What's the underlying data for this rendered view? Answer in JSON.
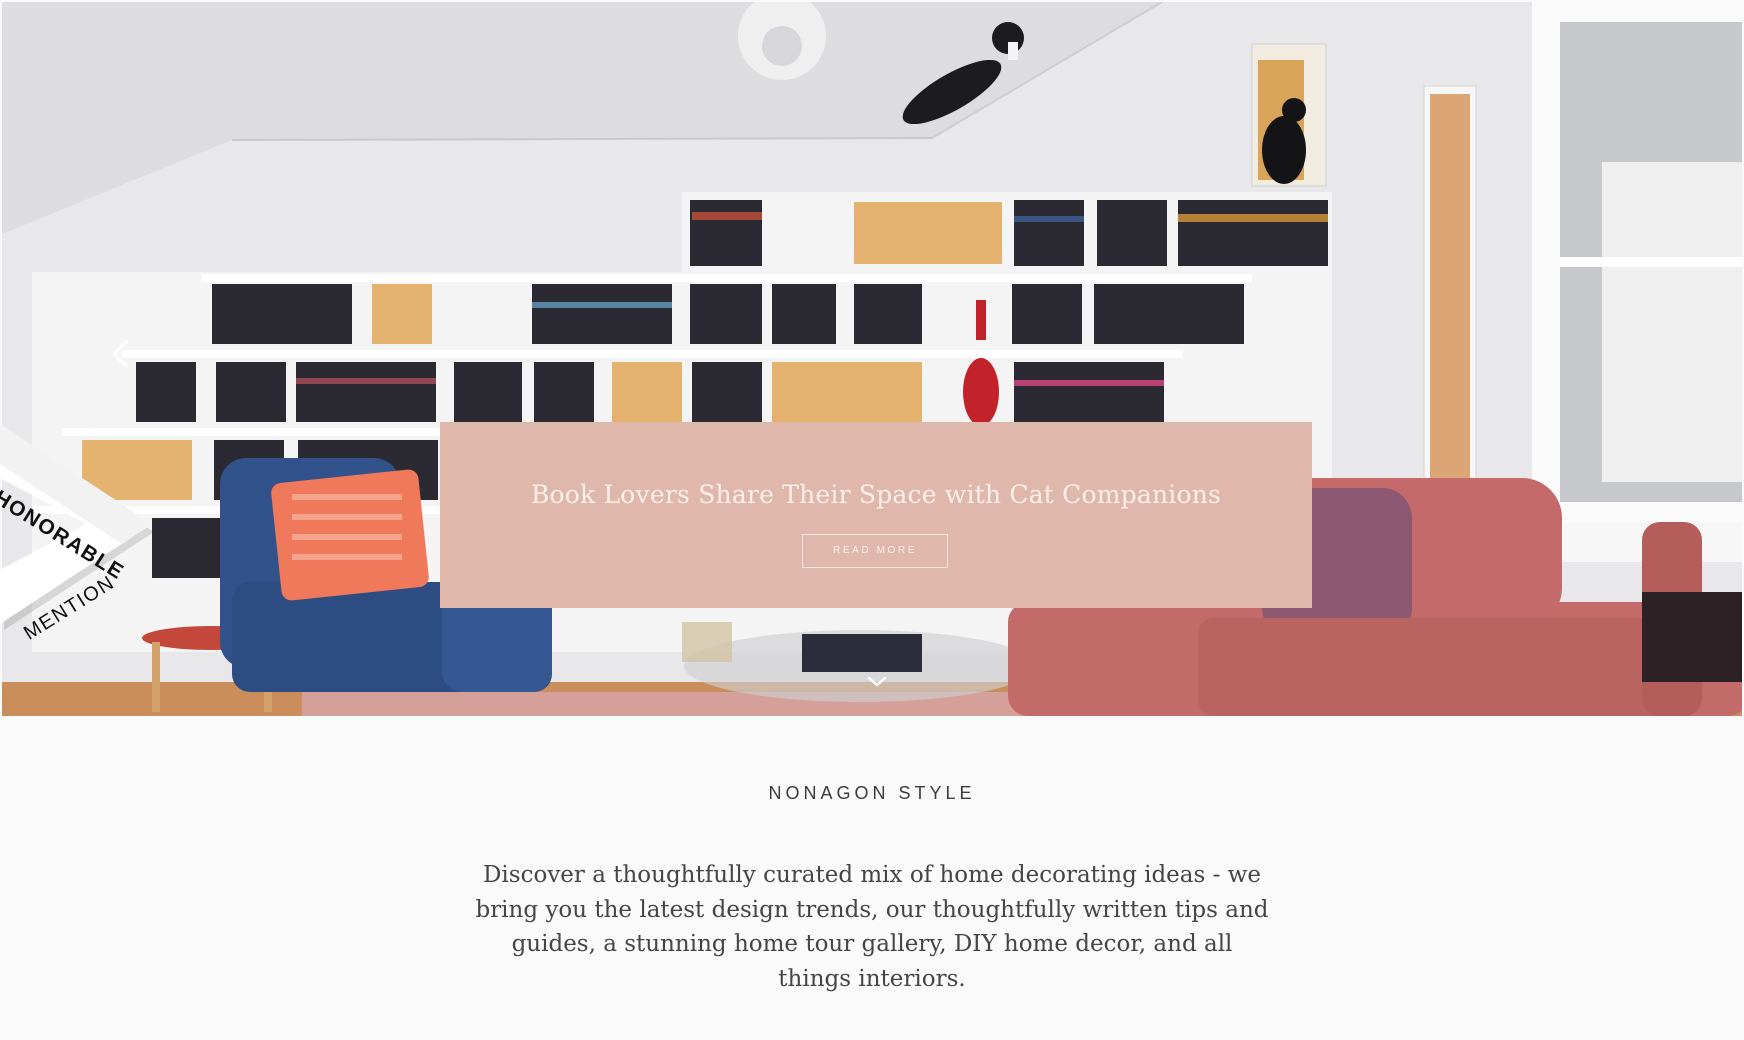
{
  "hero": {
    "image_alt": "Living room with white stepped bookshelves, cats, blue armchair and pink sofa",
    "slide_title": "Book Lovers Share Their Space with Cat Companions",
    "read_more_label": "READ MORE",
    "prev_icon": "chevron-left-icon",
    "scroll_icon": "chevron-down-icon",
    "overlay_color": "#e0b7ab"
  },
  "badge": {
    "line1": "HONORABLE",
    "line2": "MENTION"
  },
  "intro": {
    "brand": "NONAGON STYLE",
    "tagline": "Discover a thoughtfully curated mix of home decorating ideas - we bring you the latest design trends, our thoughtfully written tips and guides, a stunning home tour gallery, DIY home decor, and all things interiors."
  }
}
